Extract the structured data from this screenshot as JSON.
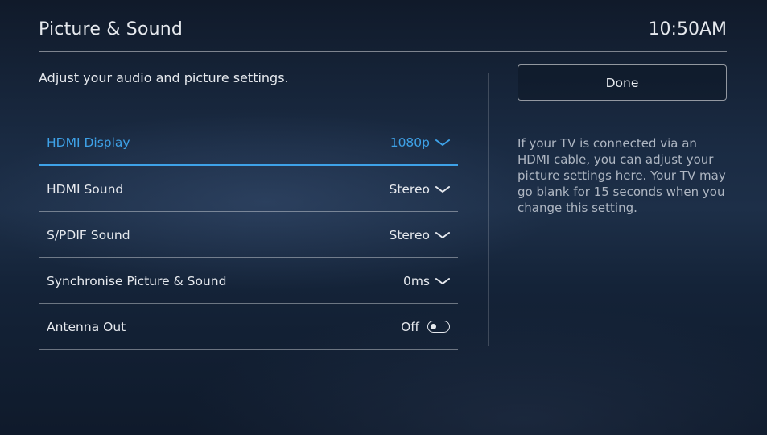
{
  "header": {
    "title": "Picture & Sound",
    "time": "10:50AM"
  },
  "subtitle": "Adjust your audio and picture settings.",
  "settings": [
    {
      "label": "HDMI Display",
      "value": "1080p",
      "control": "dropdown",
      "selected": true
    },
    {
      "label": "HDMI Sound",
      "value": "Stereo",
      "control": "dropdown",
      "selected": false
    },
    {
      "label": "S/PDIF Sound",
      "value": "Stereo",
      "control": "dropdown",
      "selected": false
    },
    {
      "label": "Synchronise Picture & Sound",
      "value": "0ms",
      "control": "dropdown",
      "selected": false
    },
    {
      "label": "Antenna Out",
      "value": "Off",
      "control": "toggle",
      "selected": false
    }
  ],
  "done_label": "Done",
  "help_text": "If your TV is connected via an HDMI cable, you can adjust your picture settings here. Your TV may go blank for 15 seconds when you change this setting.",
  "colors": {
    "accent": "#3ea2e8",
    "text": "#e6e9ee",
    "muted": "#aeb6c2"
  },
  "icons": {
    "dropdown": "chevron-down-icon",
    "toggle": "toggle-switch-icon"
  }
}
